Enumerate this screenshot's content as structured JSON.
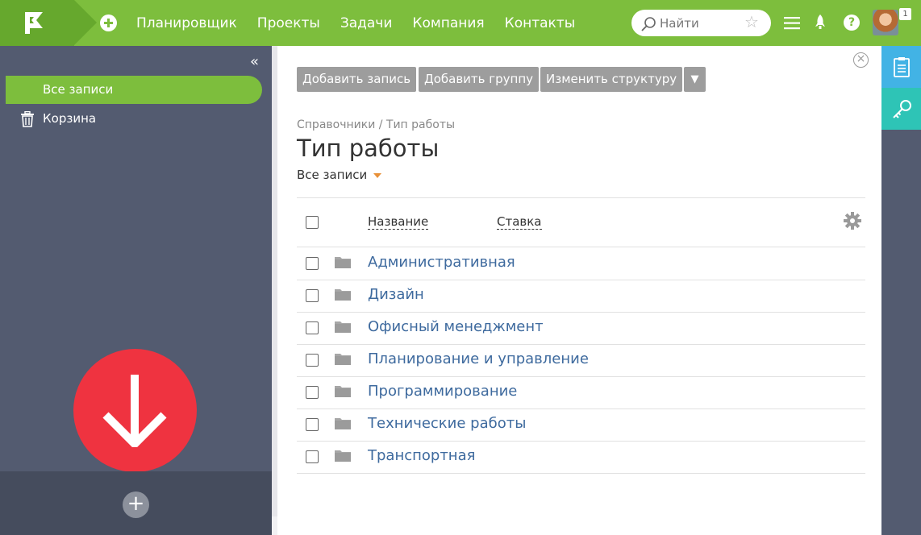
{
  "topbar": {
    "nav": [
      "Планировщик",
      "Проекты",
      "Задачи",
      "Компания",
      "Контакты"
    ],
    "search_placeholder": "Найти",
    "notification_count": "1",
    "help_label": "?"
  },
  "sidebar": {
    "collapse_glyph": "«",
    "items": [
      {
        "label": "Все записи",
        "active": true
      },
      {
        "label": "Корзина",
        "icon": "trash-icon"
      }
    ],
    "add_glyph": "+"
  },
  "toolbar": {
    "buttons": [
      "Добавить запись",
      "Добавить группу",
      "Изменить структуру"
    ],
    "dropdown_glyph": "▼"
  },
  "page": {
    "close_glyph": "×",
    "breadcrumb": "Справочники / Тип работы",
    "title": "Тип работы",
    "filter": "Все записи"
  },
  "table": {
    "columns": [
      "Название",
      "Ставка"
    ],
    "rows": [
      "Административная",
      "Дизайн",
      "Офисный менеджмент",
      "Планирование и управление",
      "Программирование",
      "Технические работы",
      "Транспортная"
    ]
  },
  "colors": {
    "accent_green": "#7dbe3d",
    "sidebar": "#535b70",
    "download_red": "#ef3340",
    "link_blue": "#3e6a9e",
    "dock_blue": "#42b3e5",
    "dock_teal": "#2ec4b6"
  }
}
